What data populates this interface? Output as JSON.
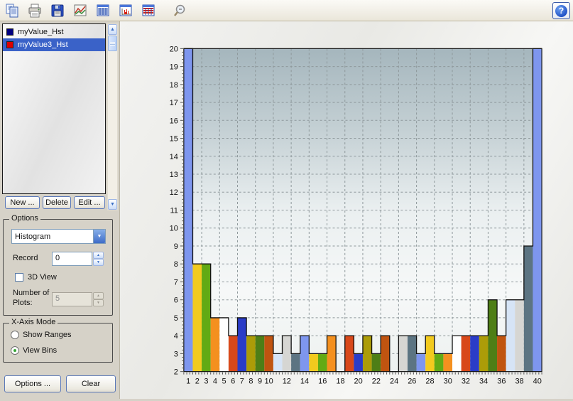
{
  "toolbar": {
    "icons": [
      "copy-icon",
      "print-icon",
      "save-icon",
      "chart-icon",
      "table-icon",
      "histogram-table-icon",
      "table-values-icon",
      "zoom-icon"
    ],
    "help_label": "?"
  },
  "sidebar": {
    "legend": {
      "selection_color": "#3A62C8",
      "items": [
        {
          "label": "myValue_Hst",
          "color": "#000080",
          "selected": false
        },
        {
          "label": "myValue3_Hst",
          "color": "#DD0000",
          "selected": true
        }
      ]
    },
    "list_buttons": {
      "new": "New ...",
      "delete": "Delete",
      "edit": "Edit ..."
    },
    "options_group": {
      "title": "Options",
      "plot_type_value": "Histogram",
      "record_label": "Record",
      "record_value": "0",
      "view_3d_label": "3D View",
      "num_plots_label_line1": "Number of",
      "num_plots_label_line2": "Plots:",
      "num_plots_value": "5"
    },
    "xaxis_group": {
      "title": "X-Axis Mode",
      "options": [
        {
          "label": "Show Ranges",
          "selected": false
        },
        {
          "label": "View Bins",
          "selected": true
        }
      ]
    },
    "bottom_buttons": {
      "options": "Options ...",
      "clear": "Clear"
    }
  },
  "chart_data": {
    "type": "bar",
    "title": "",
    "xlabel": "",
    "ylabel": "",
    "bins": [
      1,
      2,
      3,
      4,
      5,
      6,
      7,
      8,
      9,
      10,
      11,
      12,
      13,
      14,
      15,
      16,
      17,
      18,
      19,
      20,
      21,
      22,
      23,
      24,
      25,
      26,
      27,
      28,
      29,
      30,
      31,
      32,
      33,
      34,
      35,
      36,
      37,
      38,
      39,
      40
    ],
    "values": [
      20,
      8,
      8,
      5,
      5,
      4,
      5,
      4,
      4,
      4,
      3,
      4,
      3,
      4,
      3,
      3,
      4,
      2,
      4,
      3,
      4,
      3,
      4,
      2,
      4,
      4,
      3,
      4,
      3,
      3,
      4,
      4,
      4,
      4,
      6,
      4,
      6,
      6,
      9,
      20
    ],
    "bar_colors_cycle": [
      "#7E96EE",
      "#F2CA1E",
      "#62AA14",
      "#F4901F",
      "#FEFEFE",
      "#D8481A",
      "#2A3CC8",
      "#AC9C08",
      "#4E7E16",
      "#C05410",
      "#D6E4F6",
      "#D6D6D3",
      "#5C7482"
    ],
    "ylim": [
      2,
      20
    ],
    "y_ticks": [
      2,
      3,
      4,
      5,
      6,
      7,
      8,
      9,
      10,
      11,
      12,
      13,
      14,
      15,
      16,
      17,
      18,
      19,
      20
    ],
    "x_labeled_ticks": [
      1,
      2,
      3,
      4,
      5,
      6,
      7,
      8,
      9,
      10,
      12,
      14,
      16,
      18,
      20,
      22,
      24,
      26,
      28,
      30,
      32,
      34,
      36,
      38,
      40
    ],
    "grid": "dashed",
    "grid_color": "#8E989B",
    "outline_color": "#101010",
    "plot_bg_gradient": [
      "#A5B6BD",
      "#C4D0D4",
      "#EAEFF0",
      "#F6F8F8",
      "#EDF1F0"
    ],
    "legend_position": "none"
  }
}
